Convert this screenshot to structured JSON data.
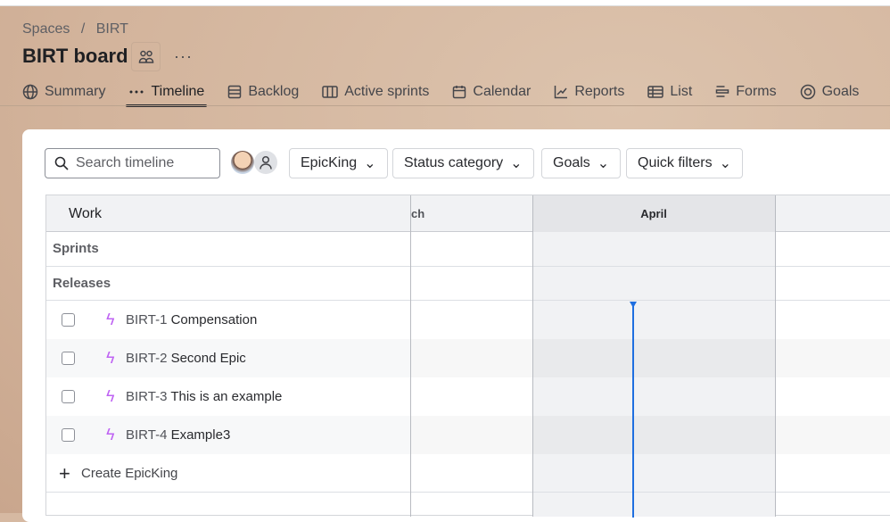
{
  "breadcrumb": {
    "spaces": "Spaces",
    "sep": "/",
    "project": "BIRT"
  },
  "title": "BIRT board",
  "more": "···",
  "tabs": [
    {
      "label": "Summary",
      "icon": "globe-icon"
    },
    {
      "label": "Timeline",
      "icon": "dots-icon"
    },
    {
      "label": "Backlog",
      "icon": "list-icon"
    },
    {
      "label": "Active sprints",
      "icon": "columns-icon"
    },
    {
      "label": "Calendar",
      "icon": "calendar-icon"
    },
    {
      "label": "Reports",
      "icon": "chart-icon"
    },
    {
      "label": "List",
      "icon": "table-icon"
    },
    {
      "label": "Forms",
      "icon": "forms-icon"
    },
    {
      "label": "Goals",
      "icon": "target-icon"
    }
  ],
  "search": {
    "placeholder": "Search timeline"
  },
  "filters": [
    "EpicKing",
    "Status category",
    "Goals",
    "Quick filters"
  ],
  "grid": {
    "work": "Work",
    "month_prev": "ch",
    "month_cur": "April",
    "sprints": "Sprints",
    "releases": "Releases",
    "create": "Create EpicKing"
  },
  "items": [
    {
      "key": "BIRT-1",
      "title": "Compensation"
    },
    {
      "key": "BIRT-2",
      "title": "Second Epic"
    },
    {
      "key": "BIRT-3",
      "title": "This is an example"
    },
    {
      "key": "BIRT-4",
      "title": "Example3"
    }
  ],
  "colors": {
    "epic": "#bf63f3",
    "today": "#1f6fe0"
  }
}
